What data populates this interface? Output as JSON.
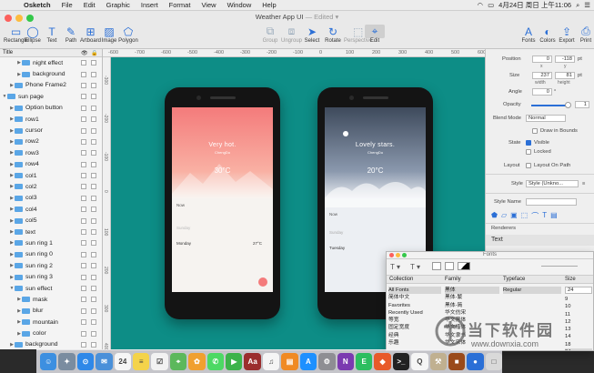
{
  "menubar": {
    "apple": "",
    "items": [
      "Osketch",
      "File",
      "Edit",
      "Graphic",
      "Insert",
      "Format",
      "View",
      "Window",
      "Help"
    ],
    "clock": "4月24日 周日 上午11:06"
  },
  "window": {
    "title": "Weather App UI",
    "edited": "— Edited ▾"
  },
  "toolbar": {
    "left": [
      {
        "label": "Rectangle",
        "icon": "rectangle-icon",
        "glyph": "▭"
      },
      {
        "label": "Ellipse",
        "icon": "ellipse-icon",
        "glyph": "◯"
      },
      {
        "label": "Text",
        "icon": "text-icon",
        "glyph": "T"
      },
      {
        "label": "Path",
        "icon": "path-icon",
        "glyph": "✎"
      },
      {
        "label": "Artboard",
        "icon": "artboard-icon",
        "glyph": "⊞"
      },
      {
        "label": "Image",
        "icon": "image-icon",
        "glyph": "▨"
      },
      {
        "label": "Polygon",
        "icon": "polygon-icon",
        "glyph": "⬠"
      }
    ],
    "mid": [
      {
        "label": "Group",
        "icon": "group-icon",
        "glyph": "⧉"
      },
      {
        "label": "Ungroup",
        "icon": "ungroup-icon",
        "glyph": "⧈"
      },
      {
        "label": "Select",
        "icon": "select-icon",
        "glyph": "➤"
      },
      {
        "label": "Rotate",
        "icon": "rotate-icon",
        "glyph": "↻"
      },
      {
        "label": "Perspective",
        "icon": "perspective-icon",
        "glyph": "⬚"
      },
      {
        "label": "Edit",
        "icon": "edit-icon",
        "glyph": "⌖"
      }
    ],
    "right": [
      {
        "label": "Fonts",
        "icon": "fonts-icon",
        "glyph": "A"
      },
      {
        "label": "Colors",
        "icon": "colors-icon",
        "glyph": "◐"
      },
      {
        "label": "Export",
        "icon": "export-icon",
        "glyph": "⇪"
      },
      {
        "label": "Print",
        "icon": "print-icon",
        "glyph": "⎙"
      }
    ]
  },
  "layers": {
    "header": "Title",
    "rows": [
      {
        "label": "night effect",
        "indent": 2,
        "expanded": false,
        "selected": false
      },
      {
        "label": "background",
        "indent": 2,
        "expanded": false,
        "selected": false
      },
      {
        "label": "Phone Frame2",
        "indent": 1,
        "expanded": false,
        "selected": false
      },
      {
        "label": "sun page",
        "indent": 0,
        "expanded": true,
        "selected": false
      },
      {
        "label": "Option button",
        "indent": 1,
        "expanded": false,
        "selected": false
      },
      {
        "label": "row1",
        "indent": 1,
        "expanded": false,
        "selected": false
      },
      {
        "label": "cursor",
        "indent": 1,
        "expanded": false,
        "selected": false
      },
      {
        "label": "row2",
        "indent": 1,
        "expanded": false,
        "selected": false
      },
      {
        "label": "row3",
        "indent": 1,
        "expanded": false,
        "selected": false
      },
      {
        "label": "row4",
        "indent": 1,
        "expanded": false,
        "selected": false
      },
      {
        "label": "col1",
        "indent": 1,
        "expanded": false,
        "selected": false
      },
      {
        "label": "col2",
        "indent": 1,
        "expanded": false,
        "selected": false
      },
      {
        "label": "col3",
        "indent": 1,
        "expanded": false,
        "selected": false
      },
      {
        "label": "col4",
        "indent": 1,
        "expanded": false,
        "selected": false
      },
      {
        "label": "col5",
        "indent": 1,
        "expanded": false,
        "selected": false
      },
      {
        "label": "text",
        "indent": 1,
        "expanded": false,
        "selected": false
      },
      {
        "label": "sun ring 1",
        "indent": 1,
        "expanded": false,
        "selected": false
      },
      {
        "label": "sun ring 0",
        "indent": 1,
        "expanded": false,
        "selected": false
      },
      {
        "label": "sun ring 2",
        "indent": 1,
        "expanded": false,
        "selected": false
      },
      {
        "label": "sun ring 3",
        "indent": 1,
        "expanded": false,
        "selected": false
      },
      {
        "label": "sun effect",
        "indent": 1,
        "expanded": true,
        "selected": false
      },
      {
        "label": "mask",
        "indent": 2,
        "expanded": false,
        "selected": false
      },
      {
        "label": "blur",
        "indent": 2,
        "expanded": false,
        "selected": false
      },
      {
        "label": "mountain",
        "indent": 2,
        "expanded": false,
        "selected": false
      },
      {
        "label": "color",
        "indent": 2,
        "expanded": false,
        "selected": false
      },
      {
        "label": "background",
        "indent": 1,
        "expanded": false,
        "selected": false
      }
    ]
  },
  "rulers": {
    "top": [
      "-600",
      "-700",
      "-600",
      "-500",
      "-400",
      "-300",
      "-200",
      "-100",
      "0",
      "100",
      "200",
      "300",
      "400",
      "500",
      "600"
    ],
    "left": [
      "-300",
      "-200",
      "-100",
      "0",
      "100",
      "200",
      "300",
      "400"
    ]
  },
  "phones": [
    {
      "theme": "day",
      "title": "Very hot.",
      "city": "ChengDu",
      "temp": "30°C",
      "rows": [
        "Now",
        "Sunday",
        "Monday"
      ],
      "day_temp": "27°C"
    },
    {
      "theme": "night",
      "title": "Lovely stars.",
      "city": "ChengDu",
      "temp": "20°C",
      "rows": [
        "Now",
        "Sunday",
        "Tuesday"
      ],
      "day_temp": ""
    }
  ],
  "inspector": {
    "position_label": "Position",
    "pos_x": "0",
    "pos_y": "-118",
    "pos_unit": "pt",
    "x_lbl": "x",
    "y_lbl": "y",
    "size_label": "Size",
    "width": "237",
    "height": "81",
    "size_unit": "pt",
    "w_lbl": "width",
    "h_lbl": "height",
    "angle_label": "Angle",
    "angle": "0",
    "angle_unit": "°",
    "opacity_label": "Opacity",
    "opacity": "1",
    "blend_label": "Blend Mode",
    "blend": "Normal",
    "draw_in_bounds": "Draw in Bounds",
    "state_label": "State",
    "visible": "Visible",
    "locked": "Locked",
    "layout_label": "Layout",
    "layout_on_path": "Layout On Path",
    "style_label": "Style",
    "style_value": "Style (Unkno...",
    "style_name_label": "Style Name",
    "renderers": "Renderers",
    "renderer_text": "Text"
  },
  "font_panel": {
    "title": "Fonts",
    "size_value": "24",
    "headers": {
      "collection": "Collection",
      "family": "Family",
      "typeface": "Typeface",
      "size": "Size"
    },
    "collections": [
      "All Fonts",
      "简体中文",
      "Favorites",
      "Recently Used",
      "等宽",
      "固定宽度",
      "经典",
      "乐趣"
    ],
    "families": [
      "黑体",
      "黑体-繁",
      "黑体-简",
      "华文仿宋",
      "华文黑体",
      "华文楷体",
      "华文隶书",
      "华文宋体"
    ],
    "typefaces": [
      "Regular",
      "",
      "",
      "",
      "",
      "",
      "",
      ""
    ],
    "sizes": [
      "9",
      "10",
      "11",
      "12",
      "13",
      "14",
      "18",
      "24"
    ]
  },
  "watermark": {
    "text": "当下软件园",
    "url": "www.downxia.com"
  },
  "dock": [
    {
      "icon": "finder-icon",
      "color": "#3d8fe0",
      "glyph": "☺"
    },
    {
      "icon": "launchpad-icon",
      "color": "#7a8ca0",
      "glyph": "✦"
    },
    {
      "icon": "safari-icon",
      "color": "#2f88e8",
      "glyph": "⊙"
    },
    {
      "icon": "mail-icon",
      "color": "#4a90d9",
      "glyph": "✉"
    },
    {
      "icon": "calendar-icon",
      "color": "#f6f6f6",
      "glyph": "24"
    },
    {
      "icon": "notes-icon",
      "color": "#f4d34a",
      "glyph": "≡"
    },
    {
      "icon": "reminders-icon",
      "color": "#f2f2f2",
      "glyph": "☑"
    },
    {
      "icon": "maps-icon",
      "color": "#5cb85c",
      "glyph": "⌖"
    },
    {
      "icon": "photos-icon",
      "color": "#f0a030",
      "glyph": "✿"
    },
    {
      "icon": "messages-icon",
      "color": "#4cd964",
      "glyph": "✆"
    },
    {
      "icon": "facetime-icon",
      "color": "#3cb34a",
      "glyph": "▶"
    },
    {
      "icon": "dictionary-icon",
      "color": "#9b2d2d",
      "glyph": "Aa"
    },
    {
      "icon": "music-icon",
      "color": "#f5f5f5",
      "glyph": "♫"
    },
    {
      "icon": "books-icon",
      "color": "#f08a24",
      "glyph": "▤"
    },
    {
      "icon": "appstore-icon",
      "color": "#1e90ff",
      "glyph": "A"
    },
    {
      "icon": "settings-icon",
      "color": "#8e8e93",
      "glyph": "⚙"
    },
    {
      "icon": "onenote-icon",
      "color": "#7b3ab0",
      "glyph": "N"
    },
    {
      "icon": "evernote-icon",
      "color": "#2dbe60",
      "glyph": "E"
    },
    {
      "icon": "app-icon",
      "color": "#e85a2a",
      "glyph": "◆"
    },
    {
      "icon": "terminal-icon",
      "color": "#222222",
      "glyph": ">_"
    },
    {
      "icon": "qq-icon",
      "color": "#f5f5f5",
      "glyph": "Q"
    },
    {
      "icon": "tool-icon",
      "color": "#c0b090",
      "glyph": "⚒"
    },
    {
      "icon": "app-icon-2",
      "color": "#9a4a1a",
      "glyph": "■"
    },
    {
      "icon": "app-icon-3",
      "color": "#2b6fd6",
      "glyph": "●"
    },
    {
      "icon": "app-icon-4",
      "color": "#d9d9d9",
      "glyph": "□"
    }
  ]
}
